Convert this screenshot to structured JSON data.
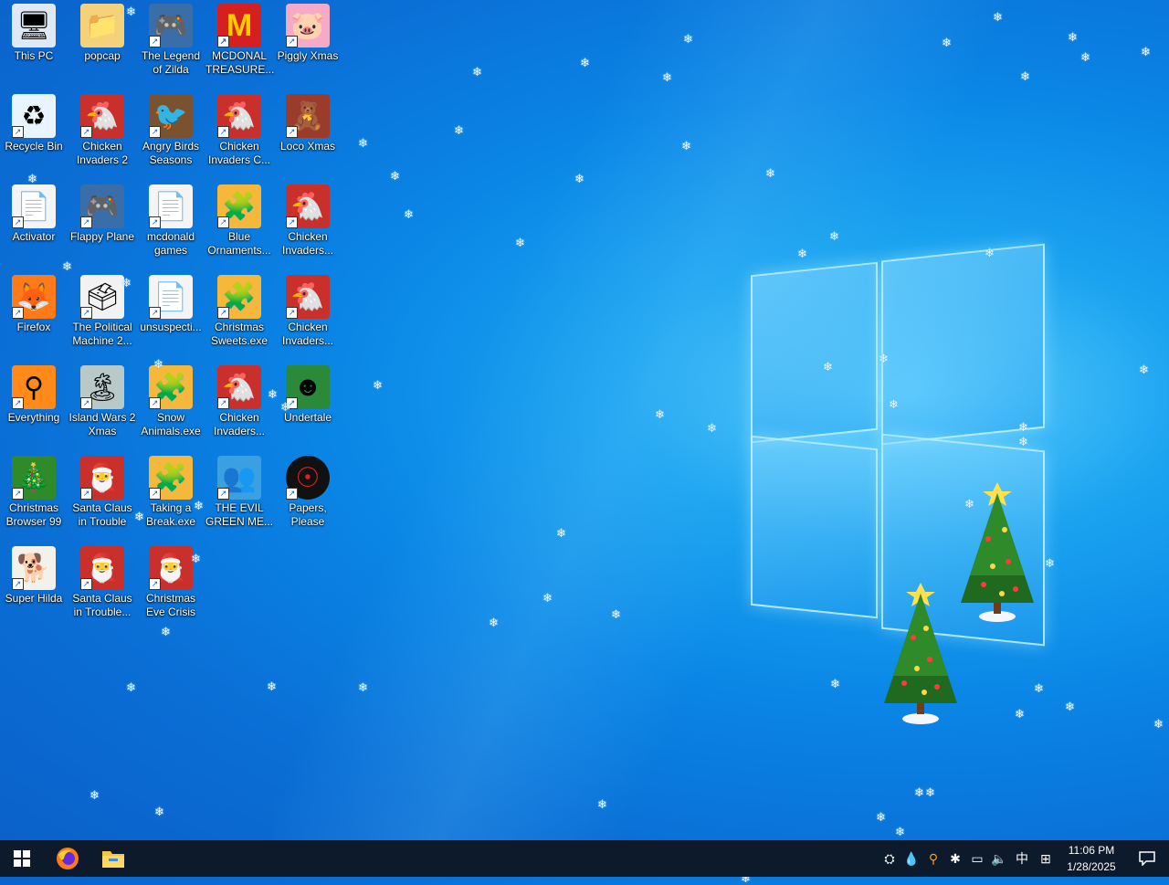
{
  "desktop": {
    "icons": [
      {
        "label": "This PC",
        "icon": "computer-icon"
      },
      {
        "label": "popcap",
        "icon": "folder-icon"
      },
      {
        "label": "The Legend\nof Zilda",
        "icon": "game-icon"
      },
      {
        "label": "MCDONAL\nTREASURE...",
        "icon": "mcdonalds-icon"
      },
      {
        "label": "Piggly Xmas",
        "icon": "pig-icon"
      },
      {
        "label": "Recycle Bin",
        "icon": "recycle-bin-icon"
      },
      {
        "label": "Chicken\nInvaders 2",
        "icon": "chicken-icon"
      },
      {
        "label": "Angry Birds\nSeasons",
        "icon": "angry-birds-icon"
      },
      {
        "label": "Chicken\nInvaders C...",
        "icon": "chicken-icon"
      },
      {
        "label": "Loco Xmas",
        "icon": "bear-icon"
      },
      {
        "label": "Activator",
        "icon": "file-icon"
      },
      {
        "label": "Flappy Plane",
        "icon": "game-icon"
      },
      {
        "label": "mcdonald\ngames",
        "icon": "file-icon"
      },
      {
        "label": "Blue\nOrnaments...",
        "icon": "puzzle-icon"
      },
      {
        "label": "Chicken\nInvaders...",
        "icon": "chicken-icon"
      },
      {
        "label": "Firefox",
        "icon": "firefox-icon"
      },
      {
        "label": "The Political\nMachine 2...",
        "icon": "political-icon"
      },
      {
        "label": "unsuspecti...",
        "icon": "file-icon"
      },
      {
        "label": "Christmas\nSweets.exe",
        "icon": "puzzle-icon"
      },
      {
        "label": "Chicken\nInvaders...",
        "icon": "chicken-icon"
      },
      {
        "label": "Everything",
        "icon": "magnifier-icon"
      },
      {
        "label": "Island Wars 2\nXmas",
        "icon": "island-icon"
      },
      {
        "label": "Snow\nAnimals.exe",
        "icon": "puzzle-icon"
      },
      {
        "label": "Chicken\nInvaders...",
        "icon": "chicken-icon"
      },
      {
        "label": "Undertale",
        "icon": "undertale-icon"
      },
      {
        "label": "Christmas\nBrowser 99",
        "icon": "tree-icon"
      },
      {
        "label": "Santa Claus\nin Trouble",
        "icon": "santa-icon"
      },
      {
        "label": "Taking a\nBreak.exe",
        "icon": "puzzle-icon"
      },
      {
        "label": "THE EVIL\nGREEN ME...",
        "icon": "people-icon"
      },
      {
        "label": "Papers,\nPlease",
        "icon": "papers-icon"
      },
      {
        "label": "Super Hilda",
        "icon": "dog-icon"
      },
      {
        "label": "Santa Claus\nin Trouble...",
        "icon": "santa-icon"
      },
      {
        "label": "Christmas\nEve Crisis",
        "icon": "santa-icon"
      }
    ]
  },
  "taskbar": {
    "start": "windows-start-icon",
    "pinned": [
      "firefox-icon",
      "file-explorer-icon"
    ],
    "tray_icons": [
      "network-people-icon",
      "droplet-icon",
      "magnifier-icon",
      "sparkle-icon",
      "network-icon",
      "volume-icon"
    ],
    "ime_label": "中",
    "ime_mode": "⊞",
    "time": "11:06 PM",
    "date": "1/28/2025",
    "notification": "notification-icon"
  }
}
